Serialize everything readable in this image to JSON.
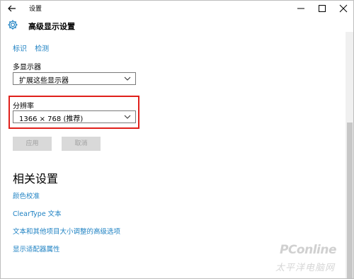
{
  "window": {
    "title": "设置",
    "header_title": "高级显示设置"
  },
  "display_links": [
    "标识",
    "检测"
  ],
  "multi_display": {
    "label": "多显示器",
    "value": "扩展这些显示器"
  },
  "resolution": {
    "label": "分辨率",
    "value": "1366 × 768 (推荐)"
  },
  "buttons": {
    "apply": "应用",
    "cancel": "取消"
  },
  "related": {
    "heading": "相关设置",
    "links": [
      "颜色校准",
      "ClearType 文本",
      "文本和其他项目大小调整的高级选项",
      "显示适配器属性"
    ]
  },
  "watermark": {
    "brand": "PConline",
    "subtitle": "太平洋电脑网"
  },
  "colors": {
    "link": "#1f82c3",
    "highlight_border": "#e0201b",
    "disabled_button": "#d9d9d9"
  },
  "icons": [
    "back-arrow-icon",
    "minimize-icon",
    "maximize-icon",
    "close-icon",
    "gear-icon",
    "chevron-down-icon"
  ]
}
